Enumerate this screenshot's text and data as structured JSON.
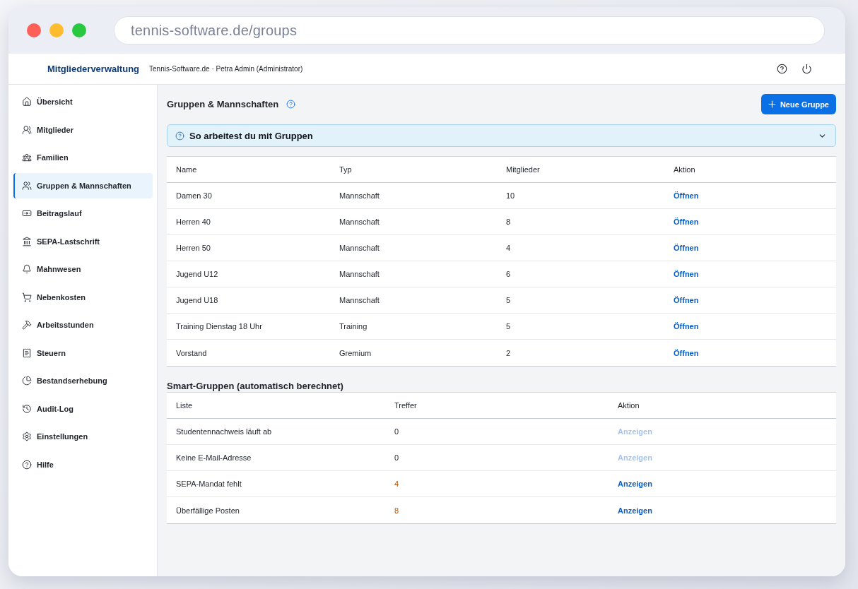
{
  "browser": {
    "url": "tennis-software.de/groups"
  },
  "header": {
    "app_name": "Mitgliederverwaltung",
    "context": "Tennis-Software.de · Petra Admin (Administrator)"
  },
  "sidebar": {
    "items": [
      {
        "label": "Übersicht",
        "selected": false
      },
      {
        "label": "Mitglieder",
        "selected": false
      },
      {
        "label": "Familien",
        "selected": false
      },
      {
        "label": "Gruppen & Mannschaften",
        "selected": true
      },
      {
        "label": "Beitragslauf",
        "selected": false
      },
      {
        "label": "SEPA-Lastschrift",
        "selected": false
      },
      {
        "label": "Mahnwesen",
        "selected": false
      },
      {
        "label": "Nebenkosten",
        "selected": false
      },
      {
        "label": "Arbeitsstunden",
        "selected": false
      },
      {
        "label": "Steuern",
        "selected": false
      },
      {
        "label": "Bestandserhebung",
        "selected": false
      },
      {
        "label": "Audit-Log",
        "selected": false
      },
      {
        "label": "Einstellungen",
        "selected": false
      },
      {
        "label": "Hilfe",
        "selected": false
      }
    ]
  },
  "page": {
    "title": "Gruppen & Mannschaften",
    "new_button": "Neue Gruppe"
  },
  "info_panel": {
    "title": "So arbeitest du mit Gruppen",
    "expanded": false
  },
  "groups_table": {
    "columns": [
      "Name",
      "Typ",
      "Mitglieder",
      "Aktion"
    ],
    "rows": [
      {
        "name": "Damen 30",
        "type": "Mannschaft",
        "members": "10",
        "action": "Öffnen"
      },
      {
        "name": "Herren 40",
        "type": "Mannschaft",
        "members": "8",
        "action": "Öffnen"
      },
      {
        "name": "Herren 50",
        "type": "Mannschaft",
        "members": "4",
        "action": "Öffnen"
      },
      {
        "name": "Jugend U12",
        "type": "Mannschaft",
        "members": "6",
        "action": "Öffnen"
      },
      {
        "name": "Jugend U18",
        "type": "Mannschaft",
        "members": "5",
        "action": "Öffnen"
      },
      {
        "name": "Training Dienstag 18 Uhr",
        "type": "Training",
        "members": "5",
        "action": "Öffnen"
      },
      {
        "name": "Vorstand",
        "type": "Gremium",
        "members": "2",
        "action": "Öffnen"
      }
    ]
  },
  "smart_groups": {
    "title": "Smart-Gruppen (automatisch berechnet)",
    "columns": [
      "Liste",
      "Treffer",
      "Aktion"
    ],
    "rows": [
      {
        "list": "Studentennachweis läuft ab",
        "hits": "0",
        "alert": false,
        "action": "Anzeigen",
        "disabled": true
      },
      {
        "list": "Keine E-Mail-Adresse",
        "hits": "0",
        "alert": false,
        "action": "Anzeigen",
        "disabled": true
      },
      {
        "list": "SEPA-Mandat fehlt",
        "hits": "4",
        "alert": true,
        "action": "Anzeigen",
        "disabled": false
      },
      {
        "list": "Überfällige Posten",
        "hits": "8",
        "alert": true,
        "action": "Anzeigen",
        "disabled": false
      }
    ]
  }
}
